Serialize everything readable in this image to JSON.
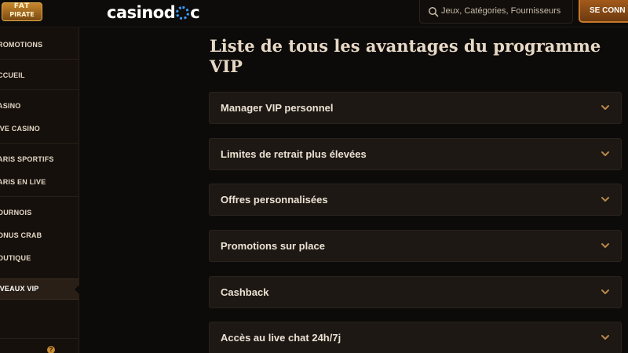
{
  "header": {
    "brand_logo_line1": "FAT",
    "brand_logo_line2": "PIRATE",
    "site_logo_text_a": "casinod",
    "site_logo_text_b": "c",
    "search_placeholder": "Jeux, Catégories, Fournisseurs",
    "login_label": "SE CONN",
    "accent_color": "#c77a2b"
  },
  "sidebar": {
    "items": [
      {
        "label": "ROMOTIONS"
      },
      {
        "label": "CCUEIL"
      },
      {
        "label": "ASINO"
      },
      {
        "label": "IVE CASINO"
      },
      {
        "label": "ARIS SPORTIFS"
      },
      {
        "label": "ARIS EN LIVE"
      },
      {
        "label": "OURNOIS"
      },
      {
        "label": "ONUS CRAB"
      },
      {
        "label": "OUTIQUE"
      },
      {
        "label": "IVEAUX VIP",
        "active": true
      }
    ],
    "help_icon": "?"
  },
  "main": {
    "title": "Liste de tous les avantages du programme VIP",
    "accordion": [
      {
        "label": "Manager VIP personnel"
      },
      {
        "label": "Limites de retrait plus élevées"
      },
      {
        "label": "Offres personnalisées"
      },
      {
        "label": "Promotions sur place"
      },
      {
        "label": "Cashback"
      },
      {
        "label": "Accès au live chat 24h/7j"
      }
    ]
  }
}
